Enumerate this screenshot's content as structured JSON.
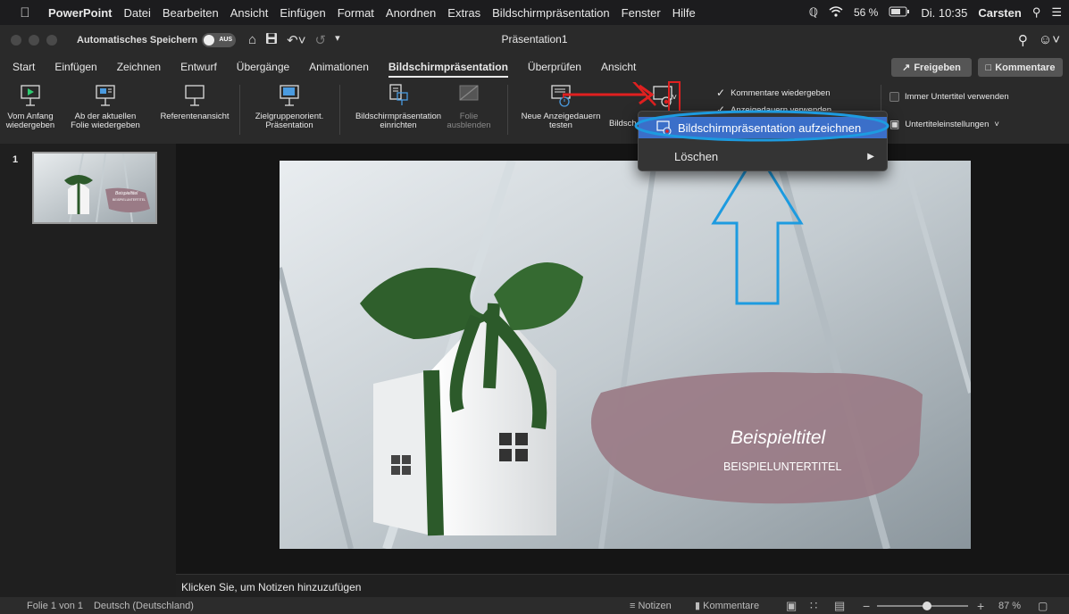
{
  "menubar": {
    "app": "PowerPoint",
    "items": [
      "Datei",
      "Bearbeiten",
      "Ansicht",
      "Einfügen",
      "Format",
      "Anordnen",
      "Extras",
      "Bildschirmpräsentation",
      "Fenster",
      "Hilfe"
    ],
    "battery": "56 %",
    "clock": "Di. 10:35",
    "user": "Carsten"
  },
  "titlebar": {
    "autosave_label": "Automatisches Speichern",
    "autosave_state": "AUS",
    "doc_title": "Präsentation1"
  },
  "tabs": [
    "Start",
    "Einfügen",
    "Zeichnen",
    "Entwurf",
    "Übergänge",
    "Animationen",
    "Bildschirmpräsentation",
    "Überprüfen",
    "Ansicht"
  ],
  "active_tab": "Bildschirmpräsentation",
  "share_label": "Freigeben",
  "comments_label": "Kommentare",
  "ribbon": {
    "from_start": [
      "Vom Anfang",
      "wiedergeben"
    ],
    "from_current": [
      "Ab der aktuellen",
      "Folie wiedergeben"
    ],
    "presenter_view": "Referentenansicht",
    "custom_show": [
      "Zielgruppenorient.",
      "Präsentation"
    ],
    "setup_show": [
      "Bildschirmpräsentation",
      "einrichten"
    ],
    "hide_slide": [
      "Folie",
      "ausblenden"
    ],
    "rehearse": [
      "Neue Anzeigedauern",
      "testen"
    ],
    "record_truncated": "Bildsch",
    "play_narrations": "Kommentare wiedergeben",
    "use_timings": "Anzeigedauern verwenden",
    "always_subtitles": "Immer Untertitel verwenden",
    "subtitle_settings": "Untertiteleinstellungen"
  },
  "dropdown": {
    "record": "Bildschirmpräsentation aufzeichnen",
    "clear": "Löschen"
  },
  "slide": {
    "number": "1",
    "title": "Beispieltitel",
    "subtitle": "BEISPIELUNTERTITEL",
    "thumb_title": "Beispieltitel",
    "thumb_subtitle": "BEISPIELUNTERTITEL"
  },
  "notes_placeholder": "Klicken Sie, um Notizen hinzuzufügen",
  "status": {
    "slide_of": "Folie 1 von 1",
    "language": "Deutsch (Deutschland)",
    "notes": "Notizen",
    "comments": "Kommentare",
    "zoom": "87 %",
    "zoom_fraction": 0.55
  },
  "colors": {
    "highlight": "#3b6fc9",
    "annotation_red": "#e02020",
    "annotation_blue": "#1d9be0",
    "brush_pink": "#9a7b86"
  }
}
